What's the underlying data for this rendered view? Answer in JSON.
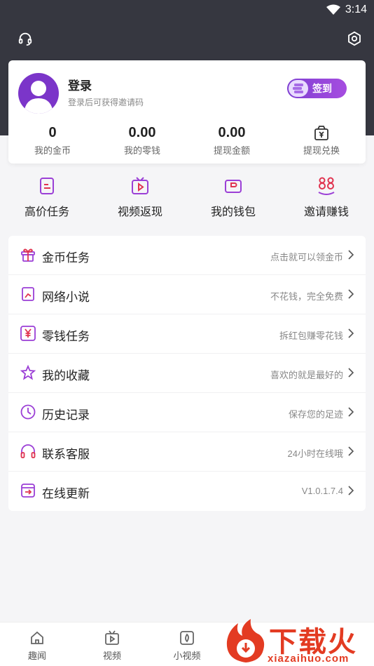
{
  "status_bar": {
    "time": "3:14"
  },
  "header": {
    "left_icon": "headset-icon",
    "right_icon": "settings-icon"
  },
  "profile": {
    "title": "登录",
    "subtitle": "登录后可获得邀请码",
    "signin_label": "签到",
    "stats": [
      {
        "value": "0",
        "label": "我的金币"
      },
      {
        "value": "0.00",
        "label": "我的零钱"
      },
      {
        "value": "0.00",
        "label": "提现金额"
      },
      {
        "value": "",
        "label": "提现兑换",
        "icon": "wallet-icon"
      }
    ]
  },
  "quick_actions": [
    {
      "label": "高价任务",
      "icon": "task-doc-icon"
    },
    {
      "label": "视频返现",
      "icon": "tv-play-icon"
    },
    {
      "label": "我的钱包",
      "icon": "wallet-card-icon"
    },
    {
      "label": "邀请赚钱",
      "icon": "invite-88-icon"
    }
  ],
  "menu": [
    {
      "label": "金币任务",
      "hint": "点击就可以领金币",
      "icon": "gift-icon"
    },
    {
      "label": "网络小说",
      "hint": "不花钱，完全免费",
      "icon": "book-icon"
    },
    {
      "label": "零钱任务",
      "hint": "拆红包赚零花钱",
      "icon": "yuan-icon"
    },
    {
      "label": "我的收藏",
      "hint": "喜欢的就是最好的",
      "icon": "star-icon"
    },
    {
      "label": "历史记录",
      "hint": "保存您的足迹",
      "icon": "clock-icon"
    },
    {
      "label": "联系客服",
      "hint": "24小时在线哦",
      "icon": "headphones-icon"
    },
    {
      "label": "在线更新",
      "hint": "V1.0.1.7.4",
      "icon": "update-icon"
    }
  ],
  "bottom_nav": [
    {
      "label": "趣闻",
      "icon": "home-icon"
    },
    {
      "label": "视频",
      "icon": "video-icon"
    },
    {
      "label": "小视频",
      "icon": "short-video-icon"
    }
  ],
  "watermark": {
    "text": "下载火",
    "sub": "xiazaihuo.com"
  },
  "colors": {
    "accent": "#7b35c9",
    "header_bg": "#363740",
    "icon_red": "#e0334f"
  }
}
